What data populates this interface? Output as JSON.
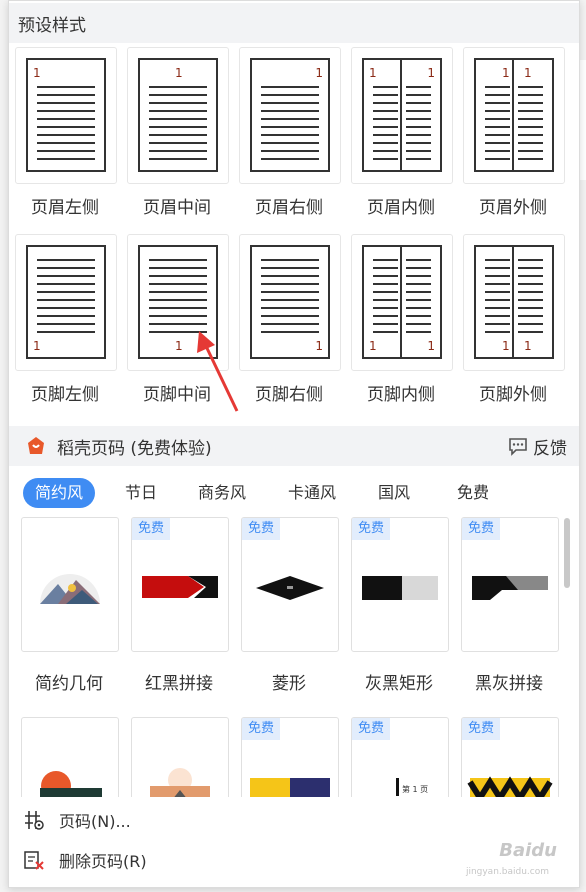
{
  "preset_section": {
    "title": "预设样式"
  },
  "header_presets": [
    {
      "label": "页眉左侧",
      "num": "1"
    },
    {
      "label": "页眉中间",
      "num": "1"
    },
    {
      "label": "页眉右侧",
      "num": "1"
    },
    {
      "label": "页眉内侧",
      "num": "1"
    },
    {
      "label": "页眉外侧",
      "num": "1"
    }
  ],
  "footer_presets": [
    {
      "label": "页脚左侧",
      "num": "1"
    },
    {
      "label": "页脚中间",
      "num": "1"
    },
    {
      "label": "页脚右侧",
      "num": "1"
    },
    {
      "label": "页脚内侧",
      "num": "1"
    },
    {
      "label": "页脚外侧",
      "num": "1"
    }
  ],
  "docer_section": {
    "title": "稻壳页码 (免费体验)",
    "feedback_label": "反馈"
  },
  "tabs": [
    "简约风",
    "节日",
    "商务风",
    "卡通风",
    "国风",
    "免费"
  ],
  "active_tab": "简约风",
  "badge_label": "免费",
  "styles_row1": [
    {
      "label": "简约几何",
      "free": false
    },
    {
      "label": "红黑拼接",
      "free": true
    },
    {
      "label": "菱形",
      "free": true
    },
    {
      "label": "灰黑矩形",
      "free": true
    },
    {
      "label": "黑灰拼接",
      "free": true
    }
  ],
  "styles_row2": [
    {
      "free": false
    },
    {
      "free": false
    },
    {
      "free": true
    },
    {
      "free": true,
      "inner_text": "第 1 页"
    },
    {
      "free": true
    }
  ],
  "menu": {
    "page_number_label": "页码(N)...",
    "delete_label": "删除页码(R)"
  },
  "watermark": {
    "text": "Baidu",
    "sub": "jingyan.baidu.com"
  },
  "colors": {
    "accent": "#3f8cf3",
    "page_number": "#8b2a16",
    "badge_bg": "#e2edfc",
    "arrow": "#e53935"
  }
}
